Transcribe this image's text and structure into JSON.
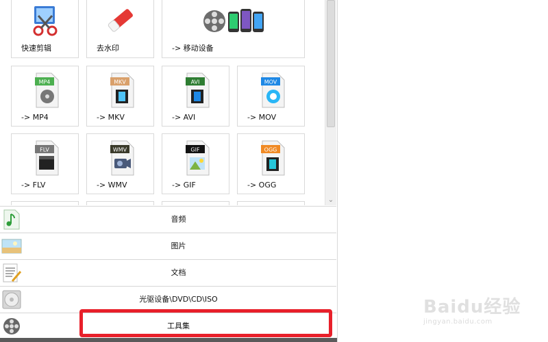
{
  "top_tiles": [
    {
      "label": "快速剪辑",
      "icon": "scissors-film-icon"
    },
    {
      "label": "去水印",
      "icon": "eraser-icon"
    },
    {
      "label": "-> 移动设备",
      "icon": "mobile-devices-icon"
    }
  ],
  "format_tiles": [
    {
      "label": "-> MP4",
      "badge": "MP4",
      "badge_color": "#4caf50",
      "icon": "mp4-file-icon"
    },
    {
      "label": "-> MKV",
      "badge": "MKV",
      "badge_color": "#d9a06b",
      "icon": "mkv-file-icon"
    },
    {
      "label": "-> AVI",
      "badge": "AVI",
      "badge_color": "#2e7d32",
      "icon": "avi-file-icon"
    },
    {
      "label": "-> MOV",
      "badge": "MOV",
      "badge_color": "#1e88e5",
      "icon": "mov-file-icon"
    },
    {
      "label": "-> FLV",
      "badge": "FLV",
      "badge_color": "#777777",
      "icon": "flv-file-icon"
    },
    {
      "label": "-> WMV",
      "badge": "WMV",
      "badge_color": "#3a3a2a",
      "icon": "wmv-file-icon"
    },
    {
      "label": "-> GIF",
      "badge": "GIF",
      "badge_color": "#111111",
      "icon": "gif-file-icon"
    },
    {
      "label": "-> OGG",
      "badge": "OGG",
      "badge_color": "#f08a24",
      "icon": "ogg-file-icon"
    }
  ],
  "categories": [
    {
      "label": "音频",
      "icon": "audio-icon"
    },
    {
      "label": "图片",
      "icon": "picture-icon"
    },
    {
      "label": "文档",
      "icon": "document-icon"
    },
    {
      "label": "光驱设备\\DVD\\CD\\ISO",
      "icon": "disc-icon"
    },
    {
      "label": "工具集",
      "icon": "film-reel-icon"
    }
  ],
  "watermark": {
    "brand": "Baidu经验",
    "url": "jingyan.baidu.com"
  },
  "colors": {
    "highlight": "#e8202a"
  }
}
